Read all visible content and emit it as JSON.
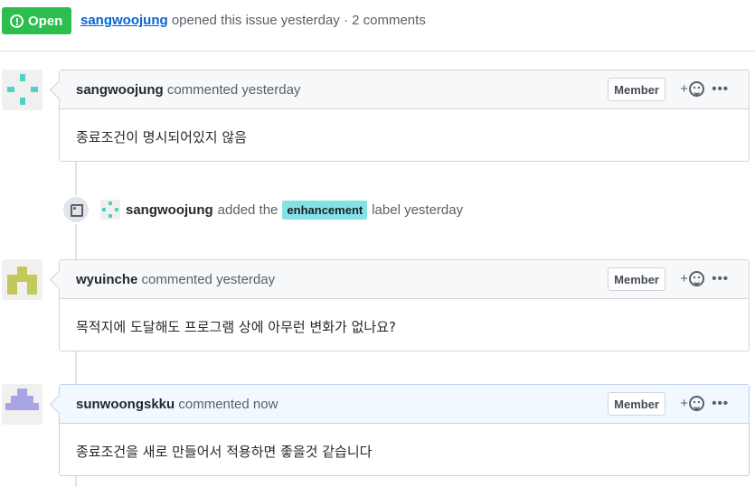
{
  "issue": {
    "state": "Open",
    "author": "sangwoojung",
    "summary": "opened this issue yesterday · 2 comments"
  },
  "comments": [
    {
      "author": "sangwoojung",
      "time": "commented yesterday",
      "badge": "Member",
      "body": "종료조건이 명시되어있지 않음",
      "avatar_color": "#4fd1c5"
    },
    {
      "author": "wyuinche",
      "time": "commented yesterday",
      "badge": "Member",
      "body": "목적지에 도달해도 프로그램 상에 아무런 변화가 없나요?",
      "avatar_color": "#c2c85a"
    },
    {
      "author": "sunwoongskku",
      "time": "commented now",
      "badge": "Member",
      "body": "종료조건을 새로 만들어서 적용하면 좋을것 같습니다",
      "avatar_color": "#a8a4e6"
    }
  ],
  "event": {
    "icon": "tag-icon",
    "actor": "sangwoojung",
    "action": "added the",
    "label": "enhancement",
    "label_color": "#84e2e7",
    "suffix": "label yesterday"
  },
  "actions": {
    "reaction_plus": "+",
    "more": "•••"
  },
  "colors": {
    "open_green": "#2cbe4e",
    "link_blue": "#0366d6"
  }
}
